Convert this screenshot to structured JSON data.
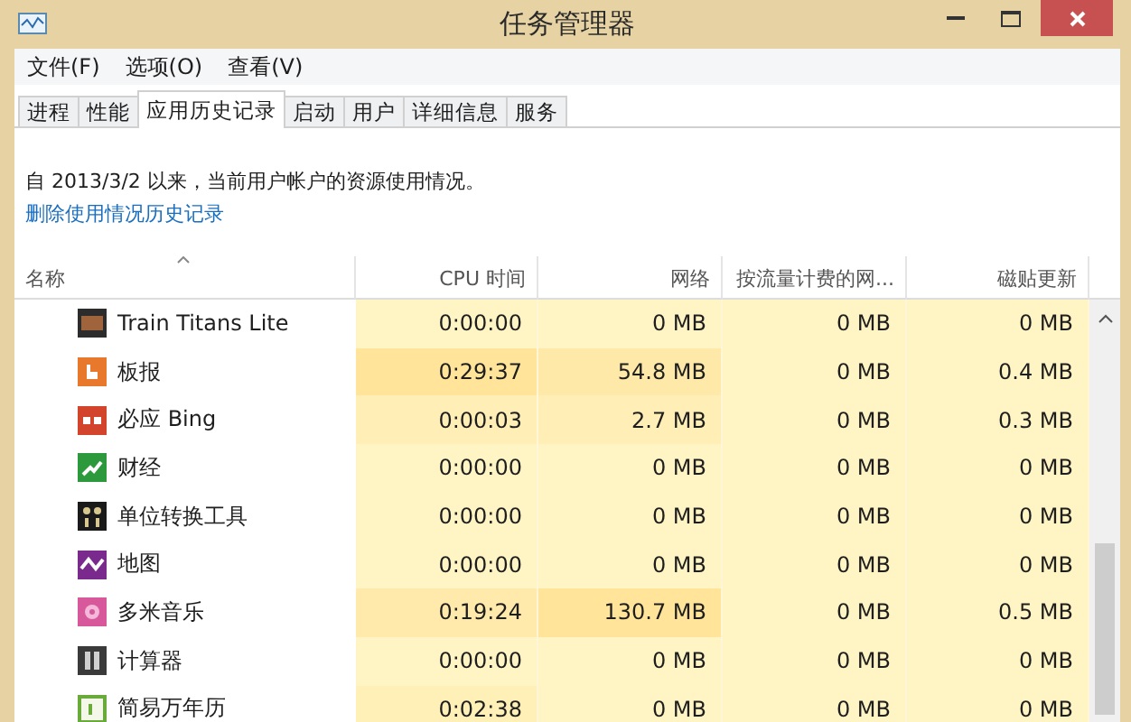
{
  "window": {
    "title": "任务管理器"
  },
  "menu": [
    "文件(F)",
    "选项(O)",
    "查看(V)"
  ],
  "tabs": [
    {
      "label": "进程",
      "selected": false
    },
    {
      "label": "性能",
      "selected": false
    },
    {
      "label": "应用历史记录",
      "selected": true
    },
    {
      "label": "启动",
      "selected": false
    },
    {
      "label": "用户",
      "selected": false
    },
    {
      "label": "详细信息",
      "selected": false
    },
    {
      "label": "服务",
      "selected": false
    }
  ],
  "info": "自 2013/3/2 以来，当前用户帐户的资源使用情况。",
  "delete_link": "删除使用情况历史记录",
  "table": {
    "columns": [
      "名称",
      "CPU 时间",
      "网络",
      "按流量计费的网...",
      "磁贴更新"
    ],
    "rows": [
      {
        "cells": [
          {
            "text": "Train Titans Lite"
          },
          {
            "text": "0:00:00",
            "color": "#fff4c4"
          },
          {
            "text": "0 MB",
            "color": "#fff4c4"
          },
          {
            "text": "0 MB",
            "color": "#fff4c4"
          },
          {
            "text": "0 MB",
            "color": "#fff4c4"
          }
        ]
      },
      {
        "cells": [
          {
            "text": "板报"
          },
          {
            "text": "0:29:37",
            "color": "#ffe49a"
          },
          {
            "text": "54.8 MB",
            "color": "#ffe9a8"
          },
          {
            "text": "0 MB",
            "color": "#fff4c4"
          },
          {
            "text": "0.4 MB",
            "color": "#fff4c4"
          }
        ]
      },
      {
        "cells": [
          {
            "text": "必应 Bing"
          },
          {
            "text": "0:00:03",
            "color": "#ffefb6"
          },
          {
            "text": "2.7 MB",
            "color": "#ffefb6"
          },
          {
            "text": "0 MB",
            "color": "#fff4c4"
          },
          {
            "text": "0.3 MB",
            "color": "#fff4c4"
          }
        ]
      },
      {
        "cells": [
          {
            "text": "财经"
          },
          {
            "text": "0:00:00",
            "color": "#fff4c4"
          },
          {
            "text": "0 MB",
            "color": "#fff4c4"
          },
          {
            "text": "0 MB",
            "color": "#fff4c4"
          },
          {
            "text": "0 MB",
            "color": "#fff4c4"
          }
        ]
      },
      {
        "cells": [
          {
            "text": "单位转换工具"
          },
          {
            "text": "0:00:00",
            "color": "#fff4c4"
          },
          {
            "text": "0 MB",
            "color": "#fff4c4"
          },
          {
            "text": "0 MB",
            "color": "#fff4c4"
          },
          {
            "text": "0 MB",
            "color": "#fff4c4"
          }
        ]
      },
      {
        "cells": [
          {
            "text": "地图"
          },
          {
            "text": "0:00:00",
            "color": "#fff4c4"
          },
          {
            "text": "0 MB",
            "color": "#fff4c4"
          },
          {
            "text": "0 MB",
            "color": "#fff4c4"
          },
          {
            "text": "0 MB",
            "color": "#fff4c4"
          }
        ]
      },
      {
        "cells": [
          {
            "text": "多米音乐"
          },
          {
            "text": "0:19:24",
            "color": "#ffeaab"
          },
          {
            "text": "130.7 MB",
            "color": "#ffe49a"
          },
          {
            "text": "0 MB",
            "color": "#fff4c4"
          },
          {
            "text": "0.5 MB",
            "color": "#fff4c4"
          }
        ]
      },
      {
        "cells": [
          {
            "text": "计算器"
          },
          {
            "text": "0:00:00",
            "color": "#fff4c4"
          },
          {
            "text": "0 MB",
            "color": "#fff4c4"
          },
          {
            "text": "0 MB",
            "color": "#fff4c4"
          },
          {
            "text": "0 MB",
            "color": "#fff4c4"
          }
        ]
      },
      {
        "cells": [
          {
            "text": "简易万年历"
          },
          {
            "text": "0:02:38",
            "color": "#fff0b8"
          },
          {
            "text": "0 MB",
            "color": "#fff4c4"
          },
          {
            "text": "0 MB",
            "color": "#fff4c4"
          },
          {
            "text": "0 MB",
            "color": "#fff4c4"
          }
        ]
      }
    ]
  }
}
